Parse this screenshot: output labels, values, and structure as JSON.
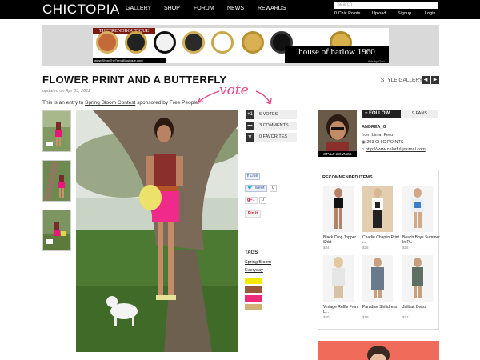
{
  "site": {
    "logo": "CHICTOPIA"
  },
  "nav": [
    "GALLERY",
    "SHOP",
    "FORUM",
    "NEWS",
    "REWARDS"
  ],
  "search": {
    "placeholder": "Search"
  },
  "user_links": [
    "0 Chic Points",
    "Upload",
    "Signup",
    "Login"
  ],
  "ad": {
    "brand": "THETRENDBOUTIQUE",
    "url": "www.ShopTheTrendBoutique.com",
    "tagline": "house of harlow 1960",
    "ads_by": "Ads by Goo..."
  },
  "post": {
    "title": "FLOWER PRINT AND A BUTTERFLY",
    "updated": "updated on Apr 03, 2012",
    "vote_note": "vote",
    "entry_prefix": "This is an entry to ",
    "contest_link": "Spring Bloom Contest",
    "entry_suffix": " sponsored by Free People."
  },
  "gallery": {
    "label": "STYLE GALLERY",
    "prev": "◀",
    "next": "▶"
  },
  "stats": {
    "votes": "5 VOTES",
    "comments": "3 COMMENTS",
    "favorites": "0 FAVORITES"
  },
  "social": {
    "like": "Like",
    "tweet": "Tweet",
    "tweet_count": "0",
    "gplus": "+1",
    "gplus_count": "0",
    "pin": "Pin it"
  },
  "tags": {
    "title": "TAGS",
    "items": [
      "Spring Bloom",
      "Everyday"
    ],
    "colors": [
      "#f3ea00",
      "#9a5a3a",
      "#ee2a7b",
      "#d2b07a"
    ]
  },
  "profile": {
    "follow": "FOLLOW",
    "fans": "9 FANS",
    "name": "ANDREA_G",
    "location": "from Lima, Peru",
    "points": "293 CHIC POINTS",
    "website": "http://www.colorful-journal.com",
    "badge": "STYLE COUNCIL"
  },
  "recommended": {
    "title": "RECOMMENDED ITEMS",
    "items": [
      {
        "name": "Black Crop Topper Shirt",
        "price": "$44"
      },
      {
        "name": "Charlie Chaplin Print ...",
        "price": "$26"
      },
      {
        "name": "Beach Boys Summer In P...",
        "price": "$26"
      },
      {
        "name": "Vintage Ruffle Front L...",
        "price": "$40"
      },
      {
        "name": "Paradise Shiftdress",
        "price": "$18"
      },
      {
        "name": "Jailbait Dress",
        "price": "$72"
      }
    ]
  }
}
